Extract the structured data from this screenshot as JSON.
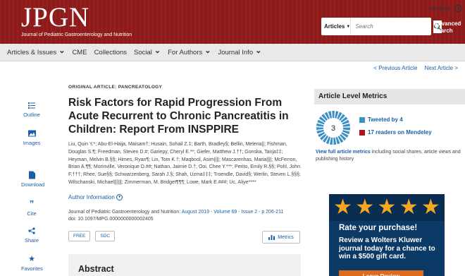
{
  "header": {
    "logo_text": "JPGN",
    "logo_subtitle": "Journal of Pediatric Gastroenterology and Nutrition",
    "search_scope": "Articles",
    "search_placeholder": "Search",
    "advanced_search": "Advanced Search",
    "search_icon": "search-icon"
  },
  "nav": {
    "items": [
      {
        "label": "Articles & Issues",
        "dropdown": true
      },
      {
        "label": "CME",
        "dropdown": false
      },
      {
        "label": "Collections",
        "dropdown": false
      },
      {
        "label": "Social",
        "dropdown": true
      },
      {
        "label": "For Authors",
        "dropdown": true
      },
      {
        "label": "Journal Info",
        "dropdown": true
      }
    ],
    "history": "History"
  },
  "pager": {
    "prev": "< Previous Article",
    "next": "Next Article >"
  },
  "rail": [
    {
      "label": "Outline",
      "icon": "outline-icon"
    },
    {
      "label": "Images",
      "icon": "images-icon"
    },
    {
      "label": "Download",
      "icon": "download-icon"
    },
    {
      "label": "Cite",
      "icon": "quote-icon"
    },
    {
      "label": "Share",
      "icon": "share-icon"
    },
    {
      "label": "Favorites",
      "icon": "star-icon"
    }
  ],
  "article": {
    "type": "ORIGINAL ARTICLE: PANCREATOLOGY",
    "title": "Risk Factors for Rapid Progression From Acute Recurrent to Chronic Pancreatitis in Children: Report From INSPPIRE",
    "authors": "Liu, Quin Y.*; Abu-El-Haija, Maisam†; Husain, Sohail Z.‡; Barth, Bradley§; Bellin, Melena||; Fishman, Douglas S.¶; Freedman, Steven D.#; Gariepy, Cheryl E.**; Giefer, Matthew J.††; Gonska, Tanja‡‡; Heyman, Melvin B.§§; Himes, Ryan¶; Lin, Tom K.†; Maqbool, Asim||||; Mascarenhas, Maria||||; McFerron, Brian A.¶¶; Morinville, Veronique D.##; Nathan, Jaimie D.†; Ooi, Chee Y.***; Perito, Emily R.§§; Pohl, John F.†††; Rhee, Sue§§; Schwarzenberg, Sarah J.§; Shah, Uzma‡‡‡; Troendle, David§; Werlin, Steven L.§§§; Wilschanski, Michael||||||; Zimmerman, M. Bridget¶¶¶; Lowe, Mark E.###; Uc, Aliye****",
    "author_info": "Author Information",
    "citation_journal": "Journal of Pediatric Gastroenterology and Nutrition: ",
    "citation_issue": "August 2019 - Volume 69 - Issue 2 - p 206-211",
    "doi": "doi: 10.1097/MPG.0000000000002405",
    "badges": [
      "FREE",
      "SDC"
    ],
    "metrics_label": "Metrics",
    "abstract_heading": "Abstract"
  },
  "metrics": {
    "heading": "Article Level Metrics",
    "score": "3",
    "tweeted": "Tweeted by 4",
    "mendeley": "17 readers on Mendeley",
    "tweet_color": "#3b8fc2",
    "mendeley_color": "#b3141b",
    "view_link": "View full article metrics",
    "view_rest": " including social shares, article views and publishing history"
  },
  "ad": {
    "stars": 5,
    "headline": "Rate your purchase!",
    "body": "Review a Wolters Kluwer journal today for a chance to win a $500 gift card.",
    "cta": "Leave Review"
  }
}
